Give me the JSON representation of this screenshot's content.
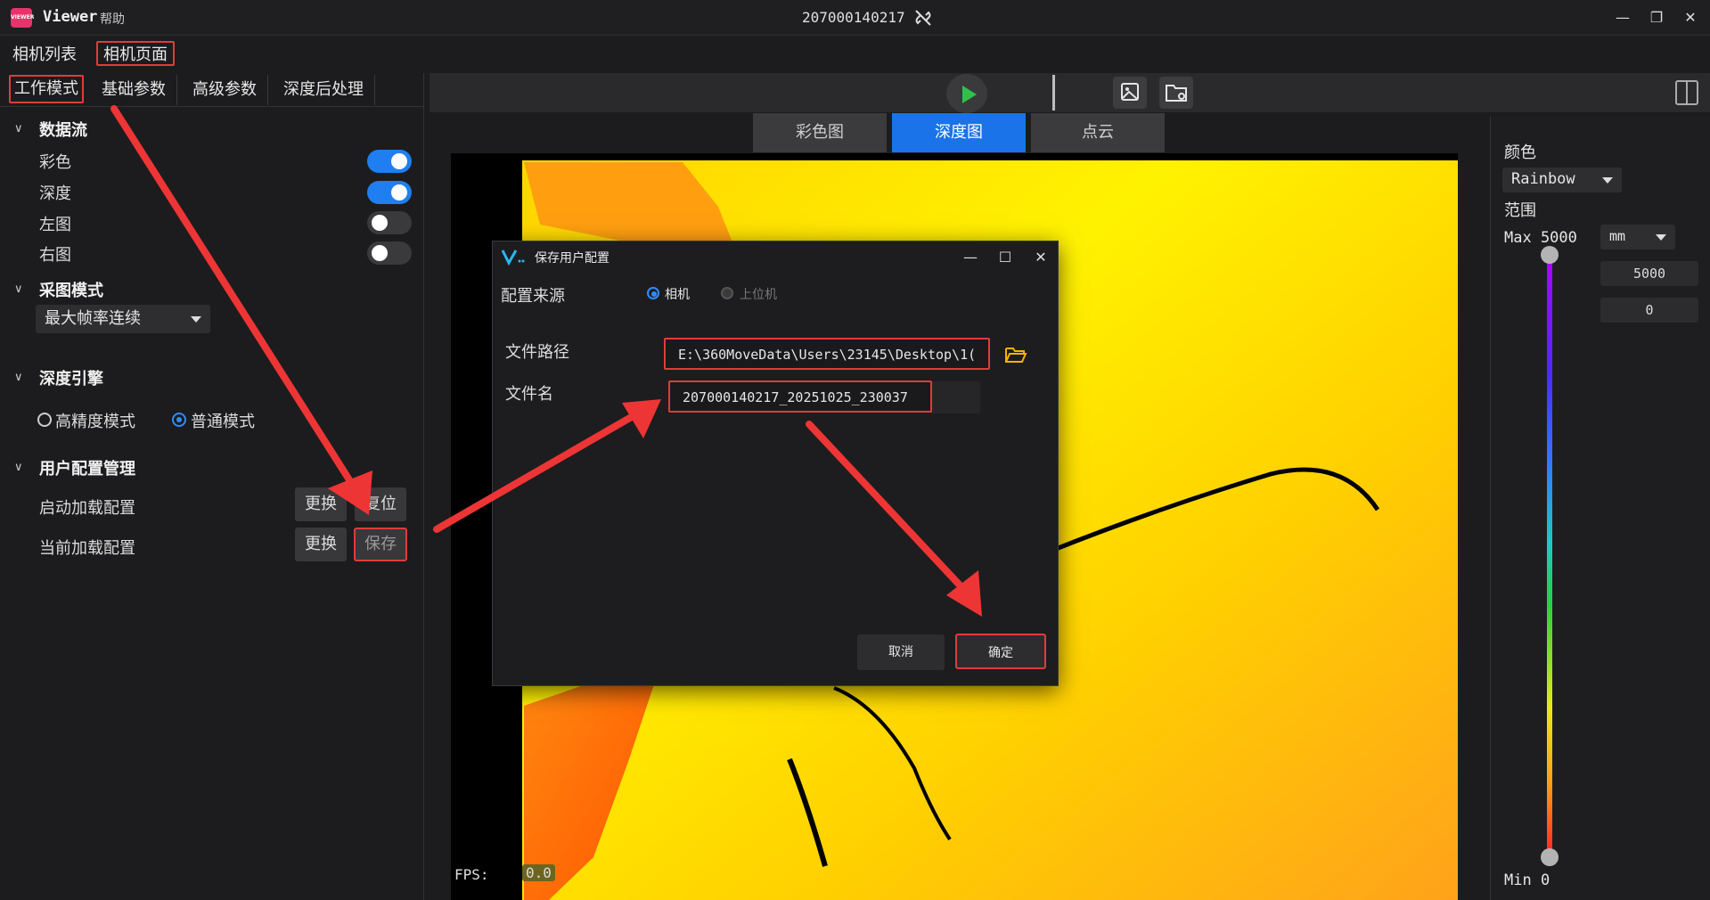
{
  "app": {
    "name": "Viewer",
    "logo_text": "VIEWER",
    "menu_help": "帮助",
    "device_id": "207000140217",
    "icons": {
      "disconnected": "link-broken-icon"
    }
  },
  "page_tabs": [
    "相机列表",
    "相机页面"
  ],
  "settings_tabs": [
    "工作模式",
    "基础参数",
    "高级参数",
    "深度后处理"
  ],
  "data_stream": {
    "title": "数据流",
    "items": [
      {
        "label": "彩色",
        "on": true
      },
      {
        "label": "深度",
        "on": true
      },
      {
        "label": "左图",
        "on": false
      },
      {
        "label": "右图",
        "on": false
      }
    ]
  },
  "capture_mode": {
    "title": "采图模式",
    "value": "最大帧率连续"
  },
  "depth_engine": {
    "title": "深度引擎",
    "options": [
      {
        "label": "高精度模式",
        "selected": false
      },
      {
        "label": "普通模式",
        "selected": true
      }
    ]
  },
  "user_config": {
    "title": "用户配置管理",
    "startup_label": "启动加载配置",
    "current_label": "当前加载配置",
    "replace": "更换",
    "reset": "复位",
    "save": "保存"
  },
  "view_tabs": [
    "彩色图",
    "深度图",
    "点云"
  ],
  "active_view": "深度图",
  "fps": {
    "label": "FPS:",
    "value": "0.0"
  },
  "right_panel": {
    "color_label": "颜色",
    "colormap": "Rainbow",
    "range_label": "范围",
    "max_label": "Max 5000",
    "unit": "mm",
    "max_input": "5000",
    "min_input": "0",
    "min_label": "Min 0"
  },
  "dialog": {
    "title": "保存用户配置",
    "source_label": "配置来源",
    "source_options": [
      {
        "label": "相机",
        "selected": true
      },
      {
        "label": "上位机",
        "selected": false
      }
    ],
    "path_label": "文件路径",
    "path_value": "E:\\360MoveData\\Users\\23145\\Desktop\\1(",
    "name_label": "文件名",
    "name_value": "207000140217_20251025_230037",
    "cancel": "取消",
    "ok": "确定"
  },
  "colors": {
    "accent": "#1a73e8",
    "highlight": "#e23b3b",
    "play": "#2ec24a"
  }
}
